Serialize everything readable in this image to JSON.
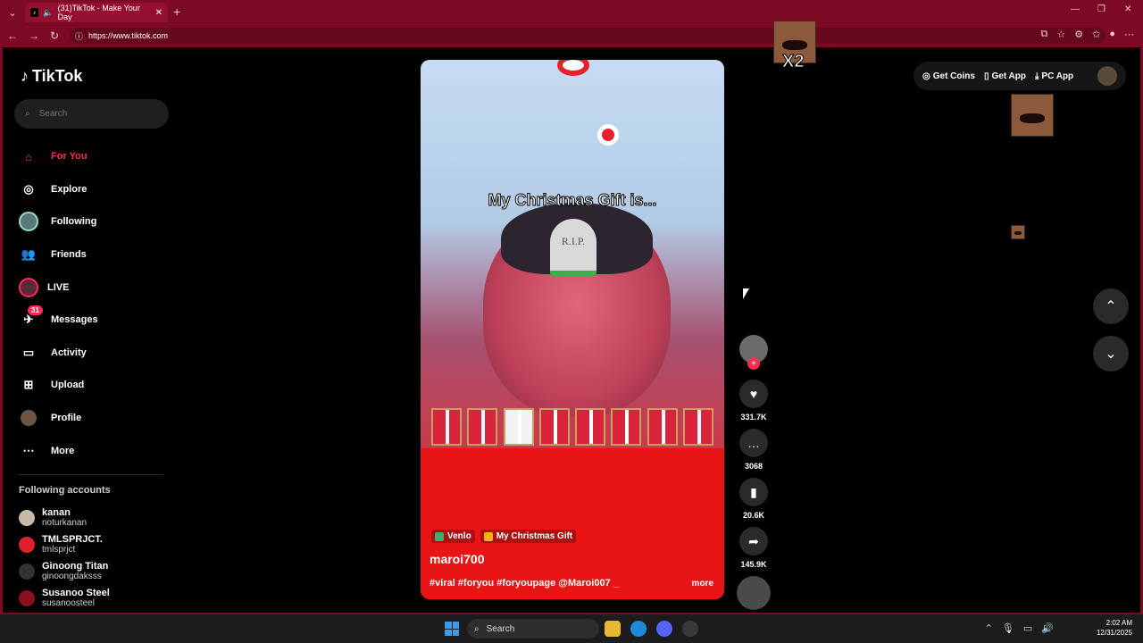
{
  "browser": {
    "tab_title": "(31)TikTok - Make Your Day",
    "url": "https://www.tiktok.com"
  },
  "sidebar": {
    "logo_text": "TikTok",
    "search_placeholder": "Search",
    "nav": [
      {
        "label": "For You",
        "icon": "home-icon",
        "active": true
      },
      {
        "label": "Explore",
        "icon": "compass-icon"
      },
      {
        "label": "Following",
        "icon": "following-avatar-icon"
      },
      {
        "label": "Friends",
        "icon": "friends-icon"
      },
      {
        "label": "LIVE",
        "icon": "live-icon"
      },
      {
        "label": "Messages",
        "icon": "messages-icon",
        "badge": "31"
      },
      {
        "label": "Activity",
        "icon": "activity-icon"
      },
      {
        "label": "Upload",
        "icon": "upload-icon"
      },
      {
        "label": "Profile",
        "icon": "profile-avatar-icon"
      },
      {
        "label": "More",
        "icon": "more-dots-icon"
      }
    ],
    "following_title": "Following accounts",
    "following": [
      {
        "name": "kanan",
        "handle": "noturkanan"
      },
      {
        "name": "TMLSPRJCT.",
        "handle": "tmlsprjct"
      },
      {
        "name": "Ginoong Titan",
        "handle": "ginoongdaksss"
      },
      {
        "name": "Susanoo Steel",
        "handle": "susanoosteel"
      }
    ]
  },
  "video": {
    "overlay_caption": "My Christmas Gift is...",
    "tombstone_text": "R.I.P.",
    "tags": [
      "Venlo",
      "My Christmas Gift"
    ],
    "author": "maroi700",
    "description": "#viral #foryou #foryoupage @Maroi007 _",
    "more_label": "more"
  },
  "actions": {
    "likes": "331.7K",
    "comments": "3068",
    "saves": "20.6K",
    "shares": "145.9K"
  },
  "topbar": {
    "get_coins": "Get Coins",
    "get_app": "Get App",
    "pc_app": "PC App"
  },
  "overlay": {
    "multiplier": "X2"
  },
  "taskbar": {
    "search_label": "Search",
    "time": "2:02 AM",
    "date": "12/31/2025"
  }
}
